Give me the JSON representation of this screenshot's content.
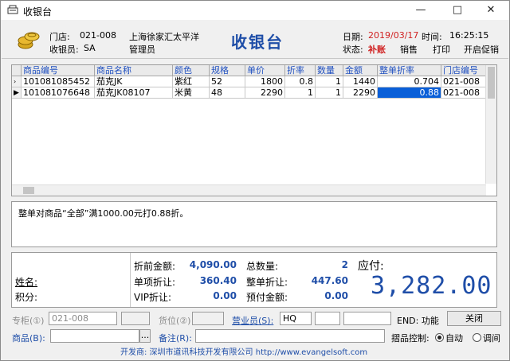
{
  "window": {
    "title": "收银台"
  },
  "header": {
    "store_label": "门店:",
    "store_code": "021-008",
    "store_name": "上海徐家汇太平洋",
    "cashier_label": "收银员:",
    "cashier_code": "SA",
    "cashier_role": "管理员",
    "big_title": "收银台",
    "date_label": "日期:",
    "date_value": "2019/03/17",
    "time_label": "时间:",
    "time_value": "16:25:15",
    "status_label": "状态:",
    "status_value": "补账",
    "actions": [
      "销售",
      "打印",
      "开启促销"
    ]
  },
  "grid": {
    "columns": [
      "商品编号",
      "商品名称",
      "颜色",
      "规格",
      "单价",
      "折率",
      "数量",
      "金额",
      "整单折率",
      "门店编号"
    ],
    "rows": [
      [
        "101081085452",
        "茄克JK",
        "紫红",
        "52",
        "1800",
        "0.8",
        "1",
        "1440",
        "0.704",
        "021-008"
      ],
      [
        "101081076648",
        "茄克JK08107",
        "米黄",
        "48",
        "2290",
        "1",
        "1",
        "2290",
        "0.88",
        "021-008"
      ]
    ]
  },
  "note": "整单对商品“全部”满1000.00元打0.88折。",
  "totals": {
    "name_label": "姓名:",
    "points_label": "积分:",
    "before_discount_label": "折前金额:",
    "before_discount_value": "4,090.00",
    "item_discount_label": "单项折让:",
    "item_discount_value": "360.40",
    "vip_discount_label": "VIP折让:",
    "vip_discount_value": "0.00",
    "total_qty_label": "总数量:",
    "total_qty_value": "2",
    "order_discount_label": "整单折让:",
    "order_discount_value": "447.60",
    "prepaid_label": "预付金额:",
    "prepaid_value": "0.00",
    "payable_label": "应付:",
    "payable_value": "3,282.00"
  },
  "bottom": {
    "counter_label": "专柜(①)",
    "counter_value": "021-008",
    "location_label": "货位(②)",
    "salesperson_label": "营业员(S):",
    "salesperson_value": "HQ",
    "end_hint": "END: 功能",
    "close_button": "关闭",
    "product_label": "商品(B):",
    "remark_label": "备注(R):",
    "browse_button": "...",
    "drawer_label": "摺品控制:",
    "drawer_options": [
      "自动",
      "调间"
    ]
  },
  "footer": "开发商: 深圳市道讯科技开发有限公司 http://www.evangelsoft.com",
  "colors": {
    "accent": "#1f4ea8",
    "selection": "#0a5fd8",
    "status": "#d02020"
  }
}
